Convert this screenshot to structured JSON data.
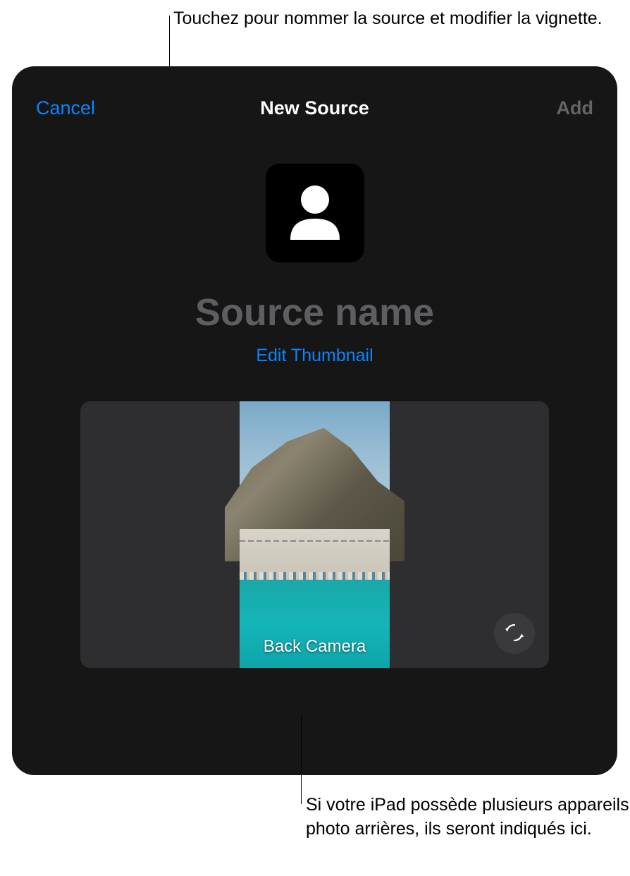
{
  "callouts": {
    "top": "Touchez pour nommer la source et modifier la vignette.",
    "bottom": "Si votre iPad possède plusieurs appareils photo arrières, ils seront indiqués ici."
  },
  "modal": {
    "cancel_label": "Cancel",
    "title": "New Source",
    "add_label": "Add",
    "source_name_placeholder": "Source name",
    "edit_thumbnail_label": "Edit Thumbnail",
    "camera_label": "Back Camera"
  },
  "icons": {
    "avatar": "person-icon",
    "flip": "flip-camera-icon"
  },
  "colors": {
    "accent": "#0a84ff",
    "modal_bg": "#161616",
    "disabled": "#646466"
  }
}
